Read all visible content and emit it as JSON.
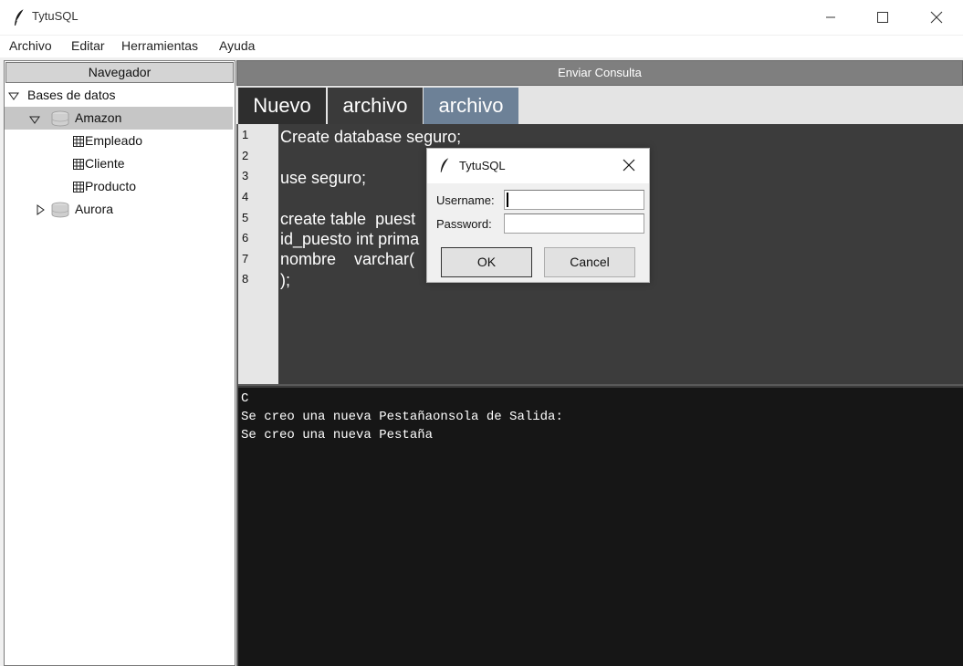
{
  "window": {
    "title": "TytuSQL",
    "icon": "feather-icon"
  },
  "menubar": {
    "items": [
      "Archivo",
      "Editar",
      "Herramientas",
      "Ayuda"
    ]
  },
  "navigator": {
    "header": "Navegador",
    "tree": {
      "root": "Bases de datos",
      "databases": [
        {
          "name": "Amazon",
          "expanded": true,
          "tables": [
            "Empleado",
            "Cliente",
            "Producto"
          ]
        },
        {
          "name": "Aurora",
          "expanded": false,
          "tables": []
        }
      ]
    }
  },
  "toolbar": {
    "send_query_label": "Enviar Consulta"
  },
  "tabs": [
    {
      "label": "Nuevo"
    },
    {
      "label": "archivo"
    },
    {
      "label": "archivo"
    }
  ],
  "editor": {
    "line_numbers": [
      "1",
      "2",
      "3",
      "4",
      "5",
      "6",
      "7",
      "8"
    ],
    "lines": [
      "Create database seguro;",
      "",
      "use seguro;",
      "",
      "create table  puest",
      "id_puesto int prima",
      "nombre    varchar(",
      ");"
    ]
  },
  "console": {
    "lines": [
      "C",
      "Se creo una nueva Pestañaonsola de Salida:",
      "Se creo una nueva Pestaña"
    ]
  },
  "login_dialog": {
    "title": "TytuSQL",
    "username_label": "Username:",
    "password_label": "Password:",
    "username_value": "",
    "password_value": "",
    "ok_label": "OK",
    "cancel_label": "Cancel"
  },
  "colors": {
    "editor_bg": "#3c3c3c",
    "console_bg": "#161616",
    "active_tab": "#6d8197",
    "selected_row": "#c6c6c6"
  }
}
